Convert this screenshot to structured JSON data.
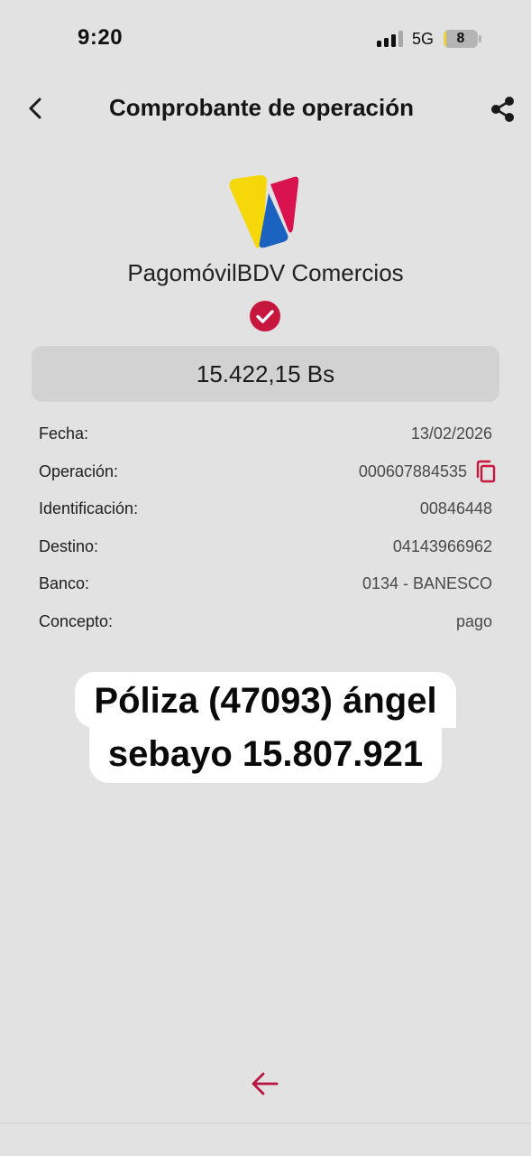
{
  "status_bar": {
    "time": "9:20",
    "network": "5G",
    "battery_level": "8",
    "battery_fraction": 0.08
  },
  "header": {
    "title": "Comprobante de operación",
    "back_icon": "chevron-left-icon",
    "share_icon": "share-icon"
  },
  "brand": {
    "name": "PagomóvilBDV Comercios",
    "logo_colors": {
      "yellow": "#f5d70a",
      "blue": "#1b62c0",
      "red": "#d8134f"
    },
    "status_icon": "check-circle-icon",
    "status_color": "#c8173f"
  },
  "amount": "15.422,15 Bs",
  "details": [
    {
      "label": "Fecha:",
      "value": "13/02/2026"
    },
    {
      "label": "Operación:",
      "value": "000607884535"
    },
    {
      "label": "Identificación:",
      "value": "00846448"
    },
    {
      "label": "Destino:",
      "value": "04143966962"
    },
    {
      "label": "Banco:",
      "value": "0134 - BANESCO"
    },
    {
      "label": "Concepto:",
      "value": "pago"
    }
  ],
  "overlay_text": {
    "line1": "Póliza (47093) ángel",
    "line2": "sebayo 15.807.921"
  },
  "footer": {
    "back_icon": "arrow-left-icon",
    "accent_color": "#b8163f"
  }
}
